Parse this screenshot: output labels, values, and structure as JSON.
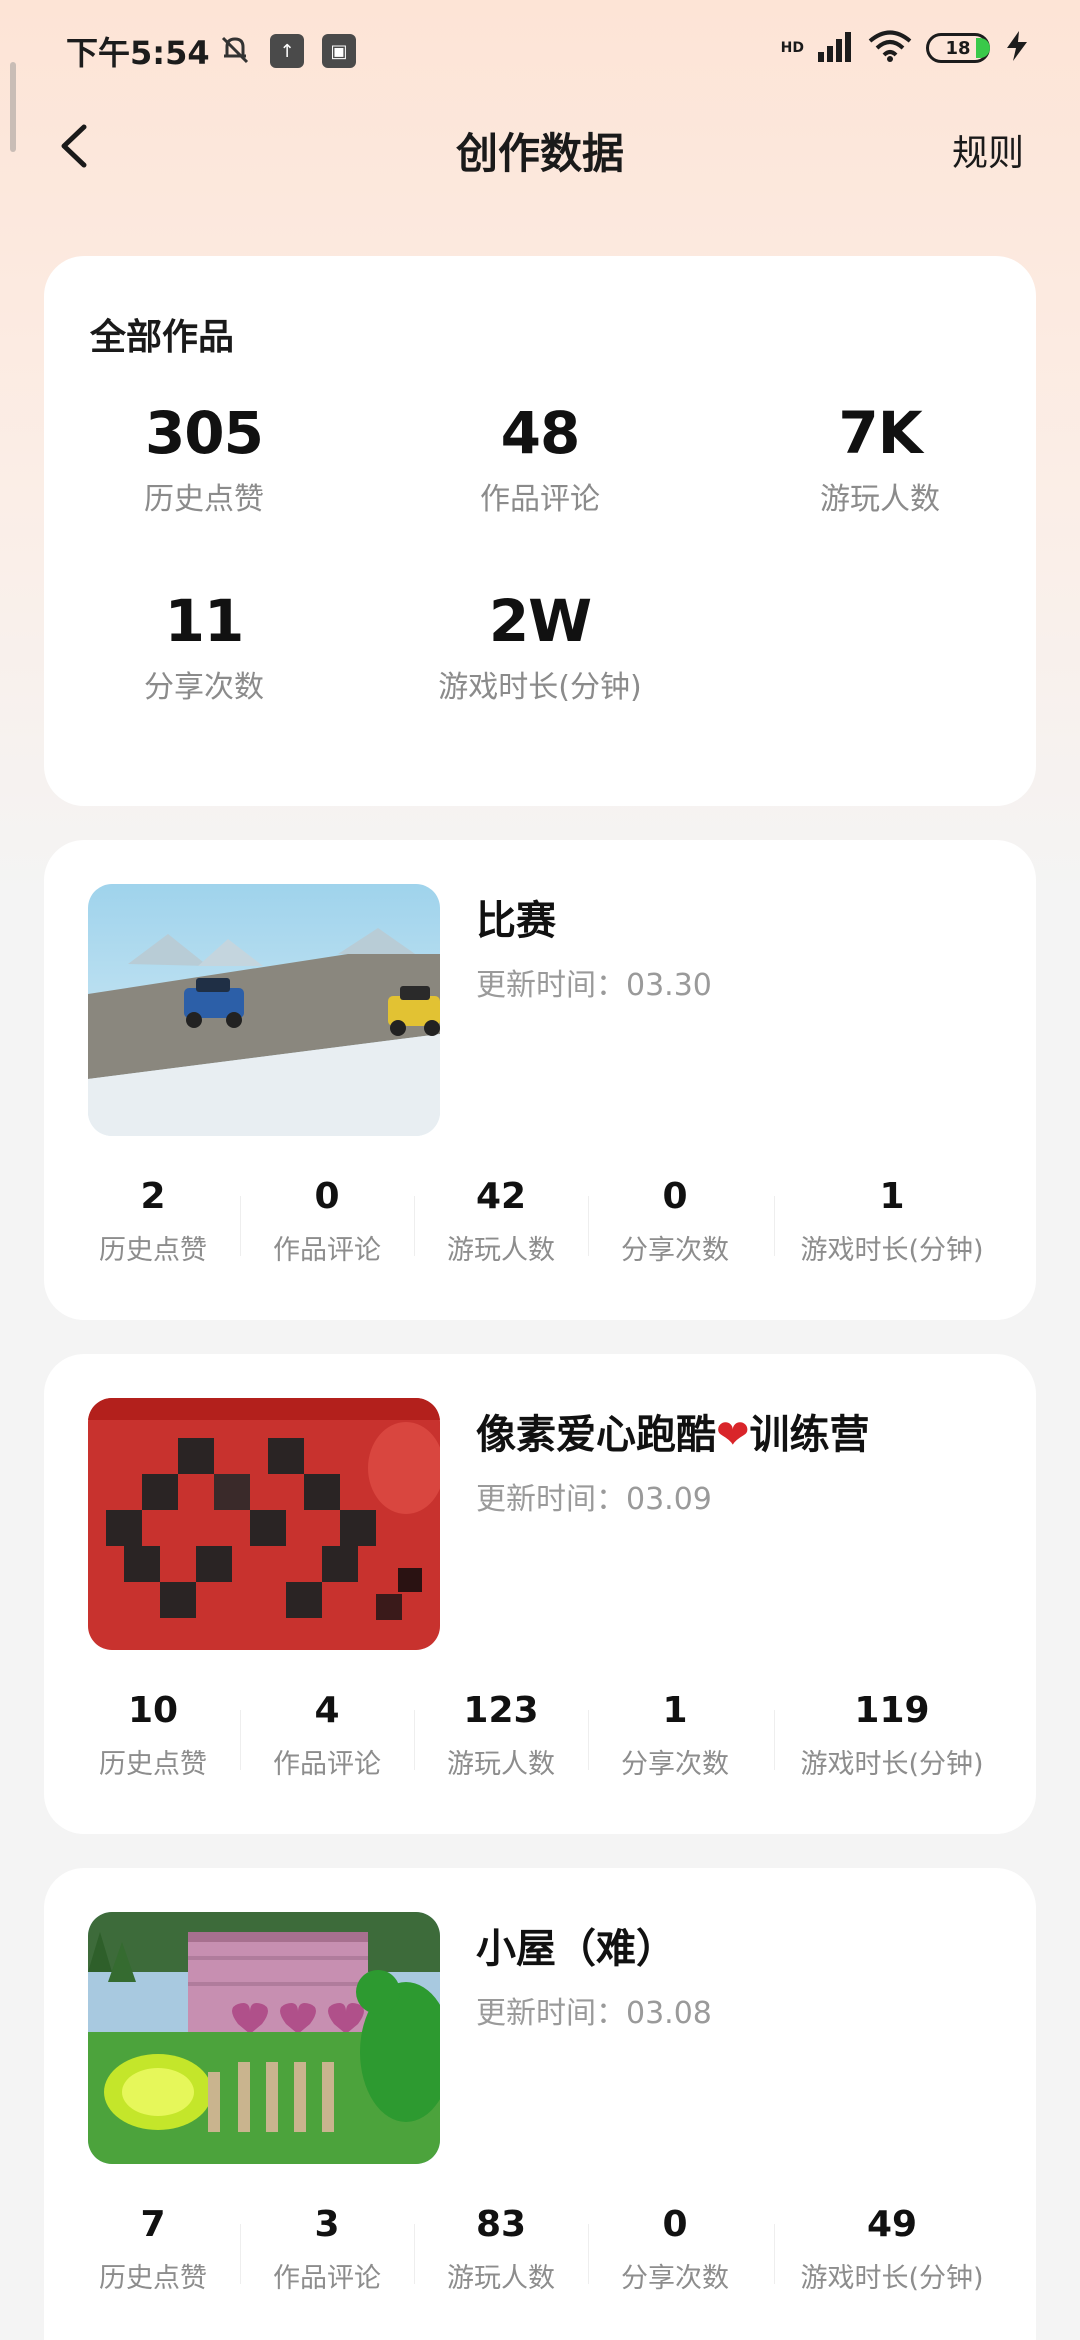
{
  "status_bar": {
    "time": "下午5:54",
    "network": "HD",
    "battery": "18"
  },
  "header": {
    "title": "创作数据",
    "rules": "规则"
  },
  "summary": {
    "title": "全部作品",
    "stats": [
      {
        "value": "305",
        "label": "历史点赞"
      },
      {
        "value": "48",
        "label": "作品评论"
      },
      {
        "value": "7K",
        "label": "游玩人数"
      },
      {
        "value": "11",
        "label": "分享次数"
      },
      {
        "value": "2W",
        "label": "游戏时长(分钟)"
      }
    ]
  },
  "works": [
    {
      "title": "比赛",
      "updated": "更新时间：03.30",
      "stats": [
        {
          "value": "2",
          "label": "历史点赞"
        },
        {
          "value": "0",
          "label": "作品评论"
        },
        {
          "value": "42",
          "label": "游玩人数"
        },
        {
          "value": "0",
          "label": "分享次数"
        },
        {
          "value": "1",
          "label": "游戏时长(分钟)"
        }
      ]
    },
    {
      "title_prefix": "像素爱心跑酷",
      "title_emoji": "❤",
      "title_suffix": "训练营",
      "updated": "更新时间：03.09",
      "stats": [
        {
          "value": "10",
          "label": "历史点赞"
        },
        {
          "value": "4",
          "label": "作品评论"
        },
        {
          "value": "123",
          "label": "游玩人数"
        },
        {
          "value": "1",
          "label": "分享次数"
        },
        {
          "value": "119",
          "label": "游戏时长(分钟)"
        }
      ]
    },
    {
      "title": "小屋（难）",
      "updated": "更新时间：03.08",
      "stats": [
        {
          "value": "7",
          "label": "历史点赞"
        },
        {
          "value": "3",
          "label": "作品评论"
        },
        {
          "value": "83",
          "label": "游玩人数"
        },
        {
          "value": "0",
          "label": "分享次数"
        },
        {
          "value": "49",
          "label": "游戏时长(分钟)"
        }
      ]
    }
  ]
}
